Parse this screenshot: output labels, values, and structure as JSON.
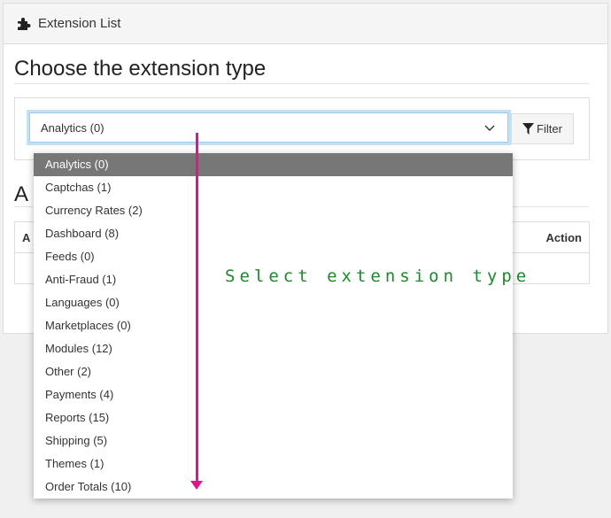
{
  "header": {
    "title": "Extension List",
    "icon": "puzzle-icon"
  },
  "main": {
    "heading": "Choose the extension type",
    "select_value": "Analytics (0)",
    "filter_label": "Filter",
    "section_heading_partial": "A",
    "table": {
      "first_col_partial": "A",
      "action_header": "Action"
    }
  },
  "dropdown": {
    "options": [
      "Analytics (0)",
      "Captchas (1)",
      "Currency Rates (2)",
      "Dashboard (8)",
      "Feeds (0)",
      "Anti-Fraud (1)",
      "Languages (0)",
      "Marketplaces (0)",
      "Modules (12)",
      "Other (2)",
      "Payments (4)",
      "Reports (15)",
      "Shipping (5)",
      "Themes (1)",
      "Order Totals (10)"
    ],
    "selected_index": 0
  },
  "annotation": {
    "text": "Select extension type",
    "text_color": "#1a8a2a",
    "arrow_color": "#e0158a"
  }
}
